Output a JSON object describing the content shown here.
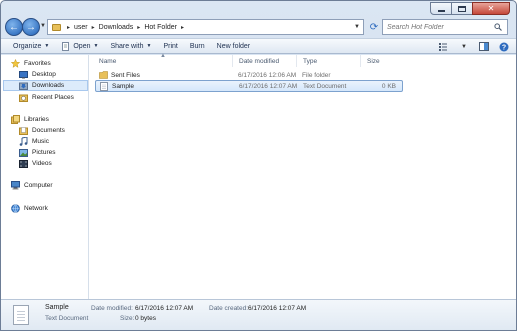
{
  "window": {
    "caption": {
      "minimize": "minimize",
      "maximize": "maximize",
      "close": "close"
    }
  },
  "address_bar": {
    "breadcrumbs": [
      "user",
      "Downloads",
      "Hot Folder"
    ]
  },
  "search": {
    "placeholder": "Search Hot Folder"
  },
  "toolbar": {
    "organize": "Organize",
    "open": "Open",
    "share_with": "Share with",
    "print": "Print",
    "burn": "Burn",
    "new_folder": "New folder"
  },
  "nav_pane": {
    "favorites": "Favorites",
    "desktop": "Desktop",
    "downloads": "Downloads",
    "recent_places": "Recent Places",
    "libraries": "Libraries",
    "documents": "Documents",
    "music": "Music",
    "pictures": "Pictures",
    "videos": "Videos",
    "computer": "Computer",
    "network": "Network"
  },
  "columns": {
    "name": "Name",
    "date_modified": "Date modified",
    "type": "Type",
    "size": "Size"
  },
  "files": [
    {
      "name": "Sent Files",
      "date_modified": "6/17/2016 12:06 AM",
      "type": "File folder",
      "size": ""
    },
    {
      "name": "Sample",
      "date_modified": "6/17/2016 12:07 AM",
      "type": "Text Document",
      "size": "0 KB"
    }
  ],
  "details": {
    "name": "Sample",
    "type": "Text Document",
    "date_modified_label": "Date modified:",
    "date_modified": "6/17/2016 12:07 AM",
    "date_created_label": "Date created:",
    "date_created": "6/17/2016 12:07 AM",
    "size_label": "Size:",
    "size": "0 bytes"
  },
  "colors": {
    "accent": "#2e6bbf",
    "selection": "#dcebfb",
    "folder": "#e8c05a"
  }
}
